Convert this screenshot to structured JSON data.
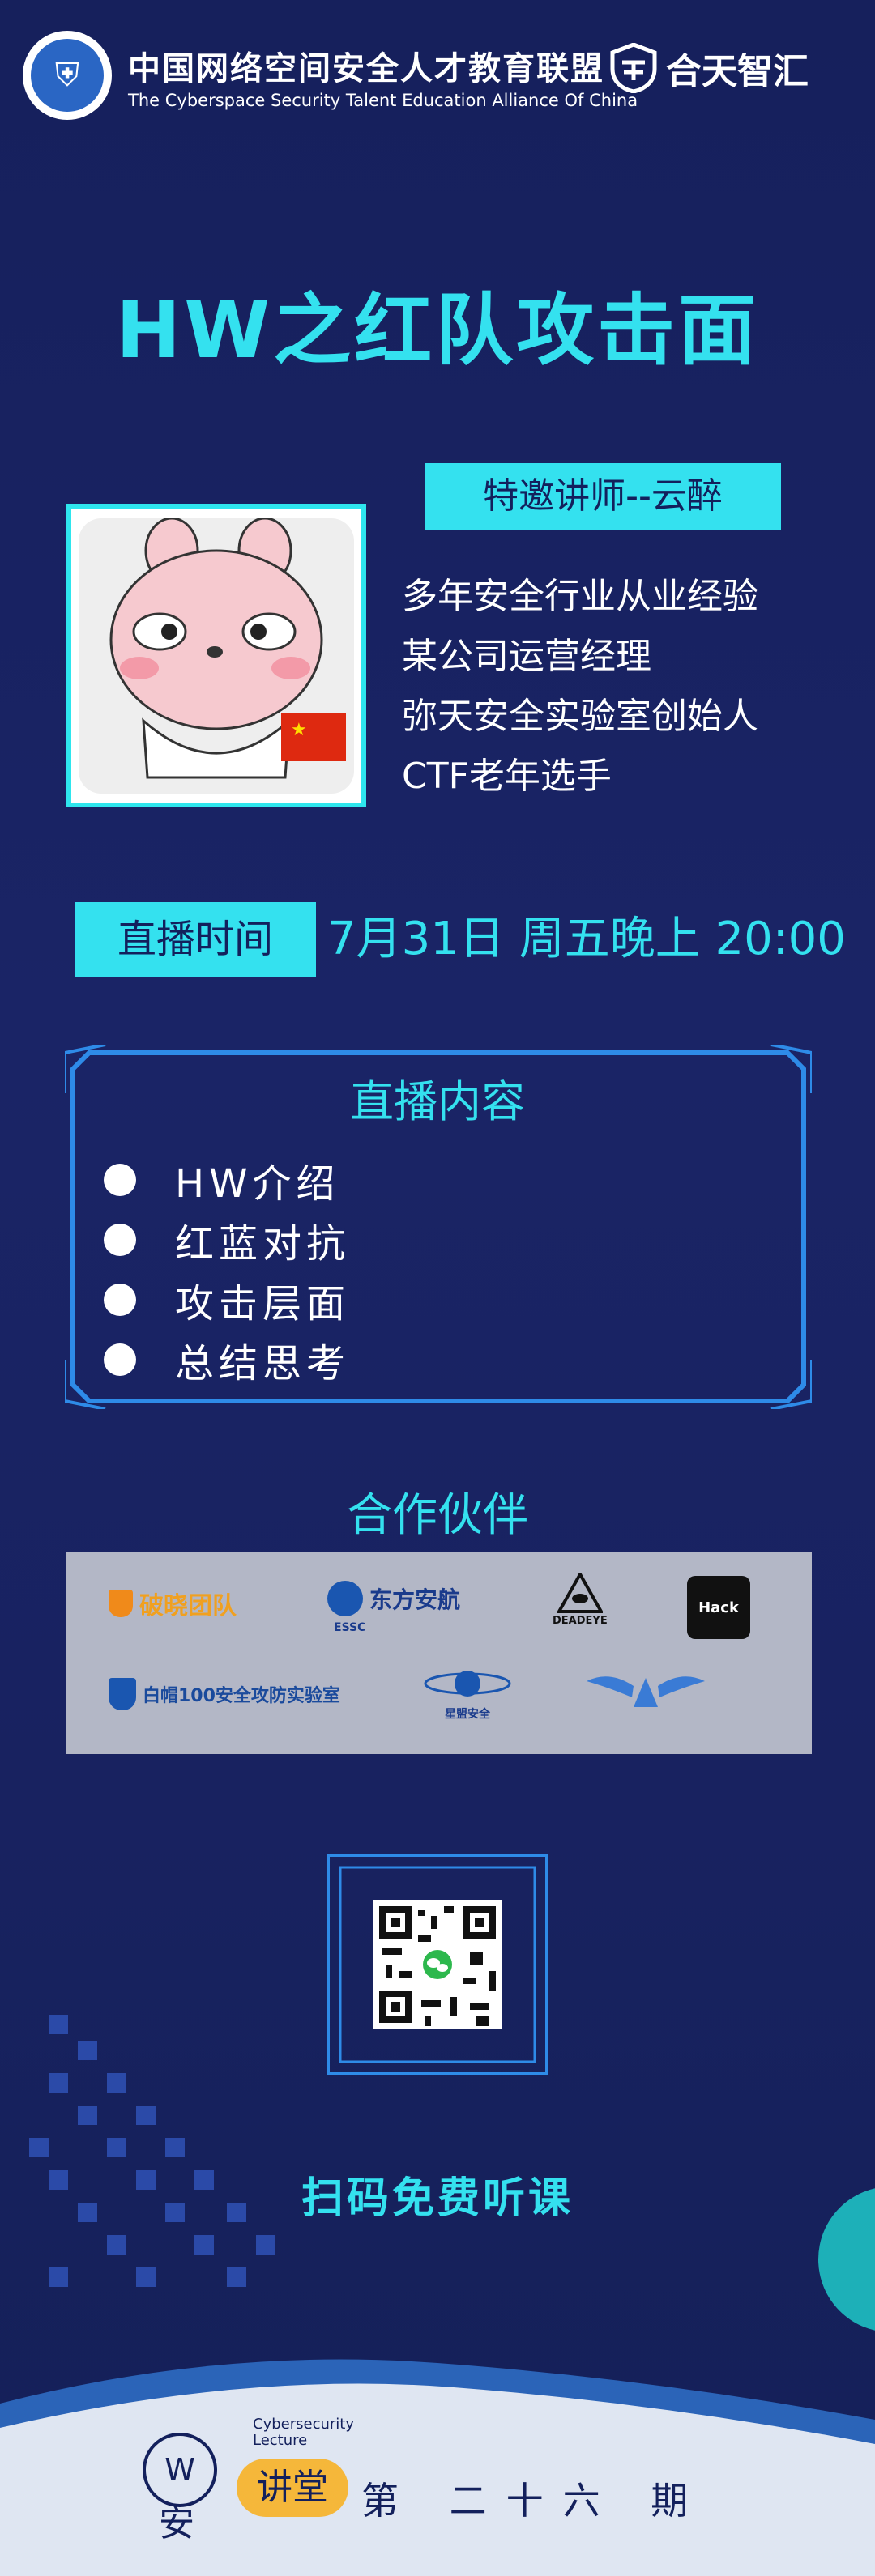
{
  "header": {
    "org_name_cn": "中国网络空间安全人才教育联盟",
    "org_name_en": "The Cyberspace Security Talent Education Alliance Of China",
    "brand": "合天智汇"
  },
  "title": "HW之红队攻击面",
  "speaker": {
    "tag": "特邀讲师--云醉",
    "bio": [
      "多年安全行业从业经验",
      "某公司运营经理",
      "弥天安全实验室创始人",
      "CTF老年选手"
    ]
  },
  "live": {
    "label": "直播时间",
    "time": "7月31日  周五晚上 20:00"
  },
  "content": {
    "title": "直播内容",
    "items": [
      "HW介绍",
      "红蓝对抗",
      "攻击层面",
      "总结思考"
    ]
  },
  "partners": {
    "title": "合作伙伴",
    "logos": [
      "破晓团队",
      "东方安航",
      "ESSC",
      "DEADEYE",
      "白帽100安全攻防实验室",
      "星盟安全",
      "Hack"
    ]
  },
  "qr": {
    "cta": "扫码免费听课"
  },
  "footer": {
    "w": "W",
    "an": "安",
    "en_line1": "Cybersecurity",
    "en_line2": "Lecture",
    "pill": "讲堂",
    "issue": "第 二十六 期"
  },
  "colors": {
    "accent": "#34e1ef",
    "bg": "#16205c",
    "pill": "#f5b73a"
  }
}
